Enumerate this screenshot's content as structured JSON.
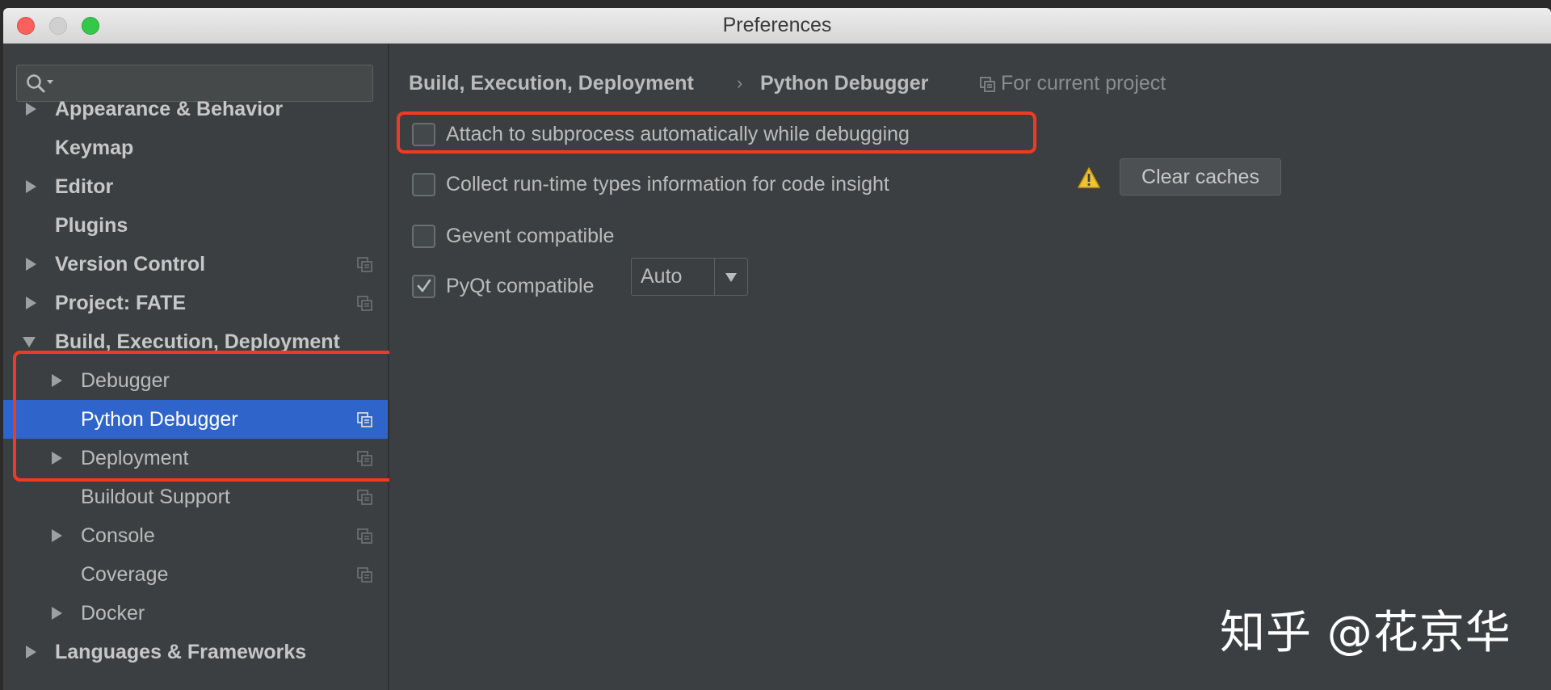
{
  "window": {
    "title": "Preferences"
  },
  "sidebar": {
    "search": {
      "placeholder": "",
      "value": ""
    },
    "items": [
      {
        "label": "Appearance & Behavior"
      },
      {
        "label": "Keymap"
      },
      {
        "label": "Editor"
      },
      {
        "label": "Plugins"
      },
      {
        "label": "Version Control"
      },
      {
        "label": "Project: FATE"
      },
      {
        "label": "Build, Execution, Deployment"
      },
      {
        "label": "Debugger"
      },
      {
        "label": "Python Debugger"
      },
      {
        "label": "Deployment"
      },
      {
        "label": "Buildout Support"
      },
      {
        "label": "Console"
      },
      {
        "label": "Coverage"
      },
      {
        "label": "Docker"
      },
      {
        "label": "Languages & Frameworks"
      }
    ],
    "selected": "Python Debugger"
  },
  "main": {
    "breadcrumb": {
      "parent": "Build, Execution, Deployment",
      "separator": "›",
      "current": "Python Debugger",
      "scope": "For current project"
    },
    "options": {
      "attach_subprocess": {
        "label": "Attach to subprocess automatically while debugging",
        "checked": false
      },
      "collect_types": {
        "label": "Collect run-time types information for code insight",
        "checked": false
      },
      "gevent": {
        "label": "Gevent compatible",
        "checked": false
      },
      "pyqt": {
        "label": "PyQt compatible",
        "checked": true,
        "selected_value": "Auto"
      }
    },
    "clear_caches_label": "Clear caches"
  },
  "watermark": "知乎 @花京华",
  "colors": {
    "selection": "#2f65ca",
    "callout": "#ef3b24",
    "warning": "#f0c330",
    "background": "#3c3f41"
  }
}
